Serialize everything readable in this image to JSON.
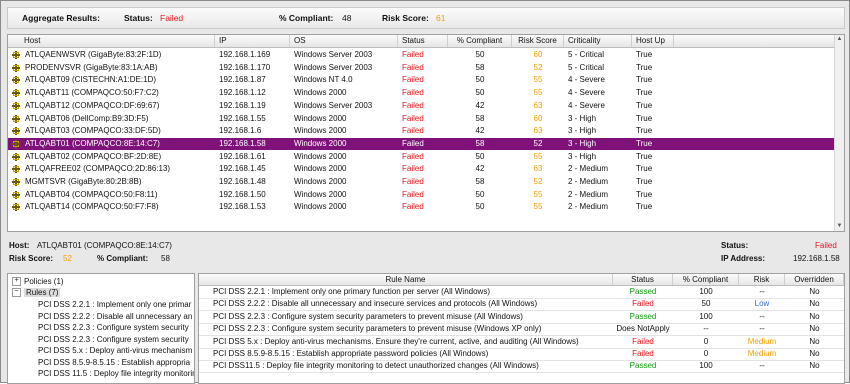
{
  "aggregate": {
    "title": "Aggregate Results:",
    "status_label": "Status:",
    "status_value": "Failed",
    "compliant_label": "% Compliant:",
    "compliant_value": "48",
    "risk_label": "Risk Score:",
    "risk_value": "61"
  },
  "host_table": {
    "columns": [
      "Host",
      "IP",
      "OS",
      "Status",
      "% Compliant",
      "Risk Score",
      "Criticality",
      "Host Up"
    ],
    "rows": [
      {
        "host": "ATLQAENWSVR (GigaByte:83:2F:1D)",
        "ip": "192.168.1.169",
        "os": "Windows Server 2003",
        "status": "Failed",
        "compliant": "50",
        "risk": "60",
        "criticality": "5 - Critical",
        "up": "True"
      },
      {
        "host": "PRODENVSVR (GigaByte:83:1A:AB)",
        "ip": "192.168.1.170",
        "os": "Windows Server 2003",
        "status": "Failed",
        "compliant": "58",
        "risk": "52",
        "criticality": "5 - Critical",
        "up": "True"
      },
      {
        "host": "ATLQABT09 (CISTECHN:A1:DE:1D)",
        "ip": "192.168.1.87",
        "os": "Windows NT 4.0",
        "status": "Failed",
        "compliant": "50",
        "risk": "55",
        "criticality": "4 - Severe",
        "up": "True"
      },
      {
        "host": "ATLQABT11 (COMPAQCO:50:F7:C2)",
        "ip": "192.168.1.12",
        "os": "Windows 2000",
        "status": "Failed",
        "compliant": "50",
        "risk": "55",
        "criticality": "4 - Severe",
        "up": "True"
      },
      {
        "host": "ATLQABT12 (COMPAQCO:DF:69:67)",
        "ip": "192.168.1.19",
        "os": "Windows Server 2003",
        "status": "Failed",
        "compliant": "42",
        "risk": "63",
        "criticality": "4 - Severe",
        "up": "True"
      },
      {
        "host": "ATLQABT06 (DellComp:B9:3D:F5)",
        "ip": "192.168.1.55",
        "os": "Windows 2000",
        "status": "Failed",
        "compliant": "58",
        "risk": "60",
        "criticality": "3 - High",
        "up": "True"
      },
      {
        "host": "ATLQABT03 (COMPAQCO:33:DF:5D)",
        "ip": "192.168.1.6",
        "os": "Windows 2000",
        "status": "Failed",
        "compliant": "42",
        "risk": "63",
        "criticality": "3 - High",
        "up": "True"
      },
      {
        "host": "ATLQABT01 (COMPAQCO:8E:14:C7)",
        "ip": "192.168.1.58",
        "os": "Windows 2000",
        "status": "Failed",
        "compliant": "58",
        "risk": "52",
        "criticality": "3 - High",
        "up": "True"
      },
      {
        "host": "ATLQABT02 (COMPAQCO:BF:2D:8E)",
        "ip": "192.168.1.61",
        "os": "Windows 2000",
        "status": "Failed",
        "compliant": "50",
        "risk": "55",
        "criticality": "3 - High",
        "up": "True"
      },
      {
        "host": "ATLQAFREE02 (COMPAQCO:2D:86:13)",
        "ip": "192.168.1.45",
        "os": "Windows 2000",
        "status": "Failed",
        "compliant": "42",
        "risk": "63",
        "criticality": "2 - Medium",
        "up": "True"
      },
      {
        "host": "MGMTSVR (GigaByte:80:2B:8B)",
        "ip": "192.168.1.48",
        "os": "Windows 2000",
        "status": "Failed",
        "compliant": "58",
        "risk": "52",
        "criticality": "2 - Medium",
        "up": "True"
      },
      {
        "host": "ATLQABT04 (COMPAQCO:50:F8:11)",
        "ip": "192.168.1.50",
        "os": "Windows 2000",
        "status": "Failed",
        "compliant": "50",
        "risk": "55",
        "criticality": "2 - Medium",
        "up": "True"
      },
      {
        "host": "ATLQABT14 (COMPAQCO:50:F7:F8)",
        "ip": "192.168.1.53",
        "os": "Windows 2000",
        "status": "Failed",
        "compliant": "50",
        "risk": "55",
        "criticality": "2 - Medium",
        "up": "True"
      }
    ],
    "selected_index": 7
  },
  "detail": {
    "host_label": "Host:",
    "host_value": "ATLQABT01 (COMPAQCO:8E:14:C7)",
    "risk_label": "Risk Score:",
    "risk_value": "52",
    "compliant_label": "% Compliant:",
    "compliant_value": "58",
    "status_label": "Status:",
    "status_value": "Failed",
    "ip_label": "IP Address:",
    "ip_value": "192.168.1.58"
  },
  "tree": {
    "policies": "Policies (1)",
    "rules": "Rules (7)",
    "items": [
      "PCI DSS 2.2.1 : Implement only one primar",
      "PCI DSS 2.2.2 : Disable all unnecessary an",
      "PCI DSS 2.2.3 : Configure system security",
      "PCI DSS 2.2.3 : Configure system security",
      "PCI DSS 5.x : Deploy anti-virus mechanism",
      "PCI DSS 8.5.9-8.5.15 : Establish appropria",
      "PCI DSS 11.5 : Deploy file integrity monitoring"
    ]
  },
  "rules_table": {
    "columns": [
      "Rule Name",
      "Status",
      "% Compliant",
      "Risk",
      "Overridden"
    ],
    "rows": [
      {
        "name": "PCI DSS 2.2.1 : Implement only one primary function per server (All Windows)",
        "status": "Passed",
        "compliant": "100",
        "risk": "--",
        "overridden": "No"
      },
      {
        "name": "PCI DSS 2.2.2 : Disable all unnecessary and insecure services and protocols (All Windows)",
        "status": "Failed",
        "compliant": "50",
        "risk": "Low",
        "overridden": "No"
      },
      {
        "name": "PCI DSS 2.2.3 : Configure system security parameters to prevent misuse (All Windows)",
        "status": "Passed",
        "compliant": "100",
        "risk": "--",
        "overridden": "No"
      },
      {
        "name": "PCI DSS 2.2.3 : Configure system security parameters to prevent misuse (Windows XP only)",
        "status": "Does NotApply",
        "compliant": "--",
        "risk": "--",
        "overridden": "No"
      },
      {
        "name": "PCI DSS 5.x : Deploy anti-virus mechanisms. Ensure they're current, active, and auditing (All Windows)",
        "status": "Failed",
        "compliant": "0",
        "risk": "Medium",
        "overridden": "No"
      },
      {
        "name": "PCI DSS 8.5.9-8.5.15 : Establish appropriate password policies (All Windows)",
        "status": "Failed",
        "compliant": "0",
        "risk": "Medium",
        "overridden": "No"
      },
      {
        "name": "PCI DSS11.5 : Deploy file integrity monitoring to detect unauthorized changes (All Windows)",
        "status": "Passed",
        "compliant": "100",
        "risk": "--",
        "overridden": "No"
      }
    ]
  },
  "colors": {
    "failed": "#e0161b",
    "passed": "#14a014",
    "risk": "#f0a000",
    "low": "#2a6fd6",
    "selected_row": "#7e1278"
  }
}
